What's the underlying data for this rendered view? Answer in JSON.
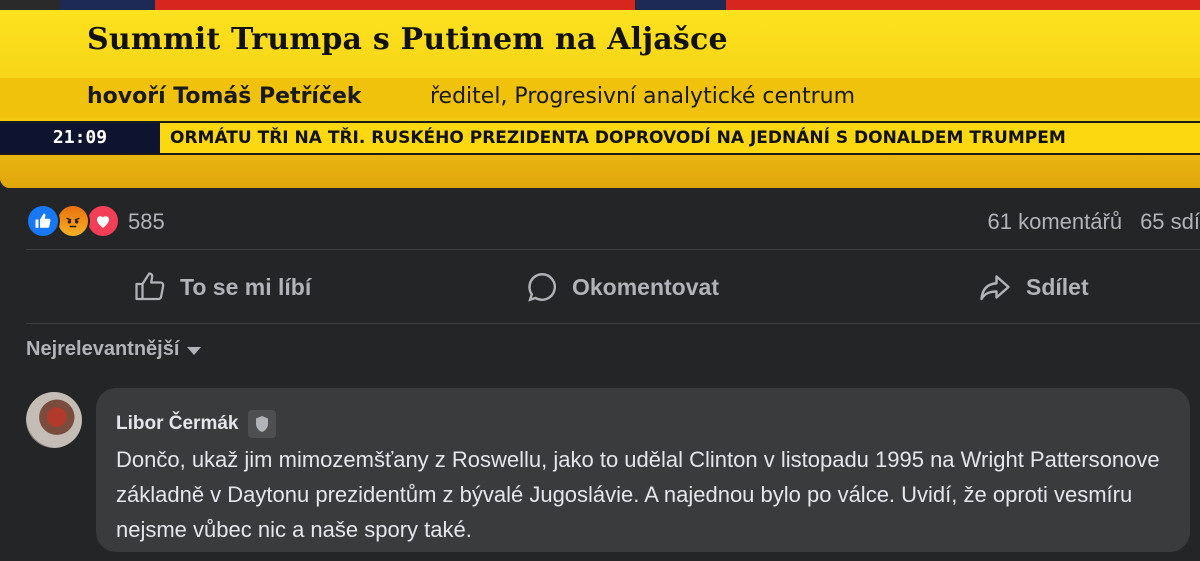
{
  "video": {
    "headline": "Summit Trumpa s Putinem na Aljašce",
    "speaker_name": "hovoří Tomáš Petříček",
    "speaker_role": "ředitel, Progresivní analytické centrum",
    "ticker_time": "21:09",
    "ticker_text": "ORMÁTU TŘI NA TŘI. RUSKÉHO PREZIDENTA DOPROVODÍ NA JEDNÁNÍ S DONALDEM TRUMPEM"
  },
  "post": {
    "reaction_count": "585",
    "reaction_icons": [
      "like-icon",
      "angry-icon",
      "love-icon"
    ],
    "comments_count": "61 komentářů",
    "shares_count": "65 sdí"
  },
  "actions": {
    "like_label": "To se mi líbí",
    "comment_label": "Okomentovat",
    "share_label": "Sdílet"
  },
  "sort": {
    "label": "Nejrelevantnější"
  },
  "comment": {
    "author": "Libor Čermák",
    "badge_icon": "shield-badge-icon",
    "text": "Dončo, ukaž jim mimozemšťany z Roswellu, jako to udělal Clinton v listopadu 1995 na Wright Pattersonove základně v Daytonu prezidentům z bývalé Jugoslávie. A najednou bylo po válce. Uvidí, že oproti vesmíru nejsme vůbec nic a naše spory také."
  },
  "colors": {
    "background": "#242526",
    "bubble": "#3a3b3c",
    "text_primary": "#e4e6eb",
    "text_secondary": "#b0b3b8",
    "broadcast_yellow": "#f1cb12",
    "like_blue": "#1877f2",
    "love_red": "#f33e58",
    "angry_orange": "#e9710f"
  }
}
